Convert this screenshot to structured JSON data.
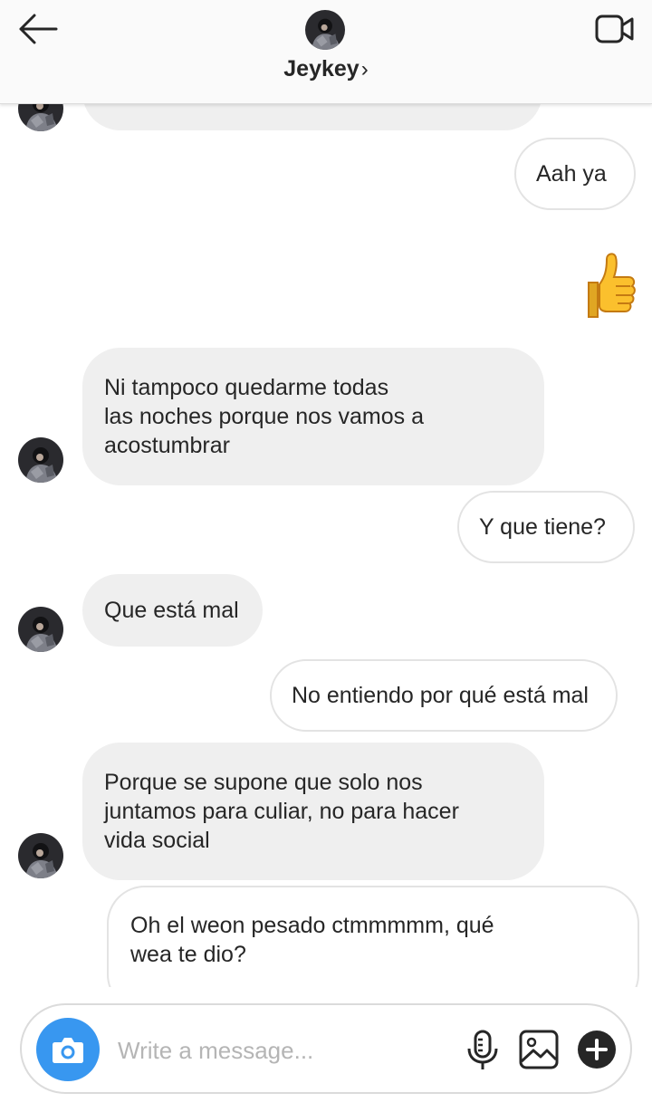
{
  "header": {
    "contact_name": "Jeykey",
    "chevron": "›"
  },
  "messages": [
    {
      "side": "in",
      "text": ""
    },
    {
      "side": "out",
      "text": "Aah ya"
    },
    {
      "side": "out",
      "text": "👍"
    },
    {
      "side": "in",
      "text": "Ni tampoco quedarme todas\nlas noches porque nos vamos a\nacostumbrar"
    },
    {
      "side": "out",
      "text": "Y que tiene?"
    },
    {
      "side": "in",
      "text": "Que está mal"
    },
    {
      "side": "out",
      "text": "No entiendo por qué está mal"
    },
    {
      "side": "in",
      "text": "Porque se supone que solo nos\njuntamos para culiar, no para hacer\nvida social"
    },
    {
      "side": "out",
      "text": "Oh el weon pesado ctmmmmm, qué\nwea te dio?"
    }
  ],
  "composer": {
    "placeholder": "Write a message..."
  },
  "icons": {
    "back": "arrow-left-icon",
    "video": "video-camera-icon",
    "camera": "camera-icon",
    "mic": "microphone-icon",
    "gallery": "image-gallery-icon",
    "plus": "plus-circle-icon"
  },
  "colors": {
    "accent": "#3897f0",
    "incoming_bubble": "#efefef",
    "outgoing_border": "#e3e3e3",
    "text": "#262626",
    "placeholder": "#b5b5b5"
  }
}
